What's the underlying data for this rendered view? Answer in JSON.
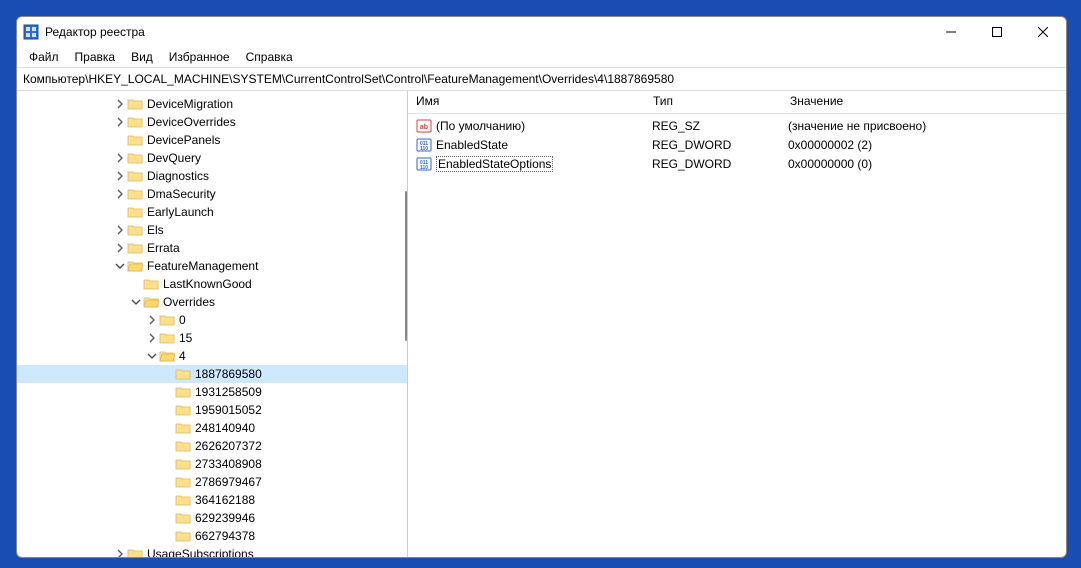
{
  "window": {
    "title": "Редактор реестра"
  },
  "menu": {
    "file": "Файл",
    "edit": "Правка",
    "view": "Вид",
    "favorites": "Избранное",
    "help": "Справка"
  },
  "address": "Компьютер\\HKEY_LOCAL_MACHINE\\SYSTEM\\CurrentControlSet\\Control\\FeatureManagement\\Overrides\\4\\1887869580",
  "columns": {
    "name": "Имя",
    "type": "Тип",
    "value": "Значение"
  },
  "values": [
    {
      "name": "(По умолчанию)",
      "type": "REG_SZ",
      "value": "(значение не присвоено)",
      "iconType": "sz",
      "selected": false
    },
    {
      "name": "EnabledState",
      "type": "REG_DWORD",
      "value": "0x00000002 (2)",
      "iconType": "dword",
      "selected": false
    },
    {
      "name": "EnabledStateOptions",
      "type": "REG_DWORD",
      "value": "0x00000000 (0)",
      "iconType": "dword",
      "selected": true
    }
  ],
  "tree": [
    {
      "depth": 6,
      "exp": ">",
      "label": "DeviceMigration"
    },
    {
      "depth": 6,
      "exp": ">",
      "label": "DeviceOverrides"
    },
    {
      "depth": 6,
      "exp": "",
      "label": "DevicePanels"
    },
    {
      "depth": 6,
      "exp": ">",
      "label": "DevQuery"
    },
    {
      "depth": 6,
      "exp": ">",
      "label": "Diagnostics"
    },
    {
      "depth": 6,
      "exp": ">",
      "label": "DmaSecurity"
    },
    {
      "depth": 6,
      "exp": "",
      "label": "EarlyLaunch"
    },
    {
      "depth": 6,
      "exp": ">",
      "label": "Els"
    },
    {
      "depth": 6,
      "exp": ">",
      "label": "Errata"
    },
    {
      "depth": 6,
      "exp": "v",
      "label": "FeatureManagement"
    },
    {
      "depth": 7,
      "exp": "",
      "label": "LastKnownGood"
    },
    {
      "depth": 7,
      "exp": "v",
      "label": "Overrides"
    },
    {
      "depth": 8,
      "exp": ">",
      "label": "0"
    },
    {
      "depth": 8,
      "exp": ">",
      "label": "15"
    },
    {
      "depth": 8,
      "exp": "v",
      "label": "4"
    },
    {
      "depth": 9,
      "exp": "",
      "label": "1887869580",
      "selected": true
    },
    {
      "depth": 9,
      "exp": "",
      "label": "1931258509"
    },
    {
      "depth": 9,
      "exp": "",
      "label": "1959015052"
    },
    {
      "depth": 9,
      "exp": "",
      "label": "248140940"
    },
    {
      "depth": 9,
      "exp": "",
      "label": "2626207372"
    },
    {
      "depth": 9,
      "exp": "",
      "label": "2733408908"
    },
    {
      "depth": 9,
      "exp": "",
      "label": "2786979467"
    },
    {
      "depth": 9,
      "exp": "",
      "label": "364162188"
    },
    {
      "depth": 9,
      "exp": "",
      "label": "629239946"
    },
    {
      "depth": 9,
      "exp": "",
      "label": "662794378"
    },
    {
      "depth": 6,
      "exp": ">",
      "label": "UsageSubscriptions"
    }
  ]
}
